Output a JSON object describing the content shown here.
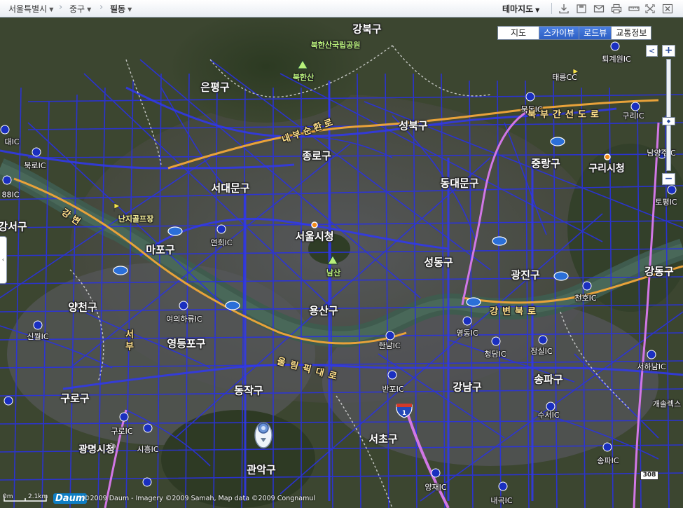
{
  "toolbar": {
    "breadcrumb": [
      "서울특별시",
      "중구",
      "필동"
    ],
    "theme_map": "테마지도"
  },
  "map_types": [
    "지도",
    "스카이뷰",
    "로드뷰",
    "교통정보"
  ],
  "active_map_types": [
    "스카이뷰",
    "로드뷰"
  ],
  "controls": {
    "zoom_in": "+",
    "zoom_out": "−",
    "left": "<"
  },
  "districts": [
    "강북구",
    "은평구",
    "성북구",
    "종로구",
    "서대문구",
    "중랑구",
    "동대문구",
    "마포구",
    "서울시청",
    "성동구",
    "광진구",
    "강동구",
    "양천구",
    "용산구",
    "영등포구",
    "송파구",
    "강남구",
    "구로구",
    "동작구",
    "서초구",
    "관악구",
    "강서구",
    "구리시청",
    "광명시청"
  ],
  "pois": [
    "북한산국립공원",
    "북한산",
    "남산",
    "난지골프장"
  ],
  "interchanges": [
    "태릉CC",
    "퇴계원IC",
    "묵동IC",
    "구리IC",
    "대IC",
    "북로IC",
    "남양주IC",
    "88IC",
    "토평IC",
    "연희IC",
    "여의하류IC",
    "천호IC",
    "신월IC",
    "한남IC",
    "영동IC",
    "청담IC",
    "잠실IC",
    "서하남IC",
    "개솔렉스",
    "반포IC",
    "수서IC",
    "구로IC",
    "시흥IC",
    "송파IC",
    "양재IC",
    "내곡IC"
  ],
  "road_labels": [
    "북부간선도로",
    "내부순환로",
    "올림픽대로",
    "강변북로",
    "강변",
    "서부"
  ],
  "route_shields": [
    "1",
    "308"
  ],
  "footer": {
    "scale_zero": "0m",
    "scale_km": "2.1km",
    "logo": "Daum",
    "copyright": "©2009 Daum - Imagery ©2009 Samah, Map data ©2009 Congnamul"
  },
  "colors": {
    "road_network": "#2a32e0",
    "highway": "#e8a23a",
    "expressway": "#c46ad8",
    "river": "#3d5a4a",
    "terrain": "#3c4630"
  }
}
